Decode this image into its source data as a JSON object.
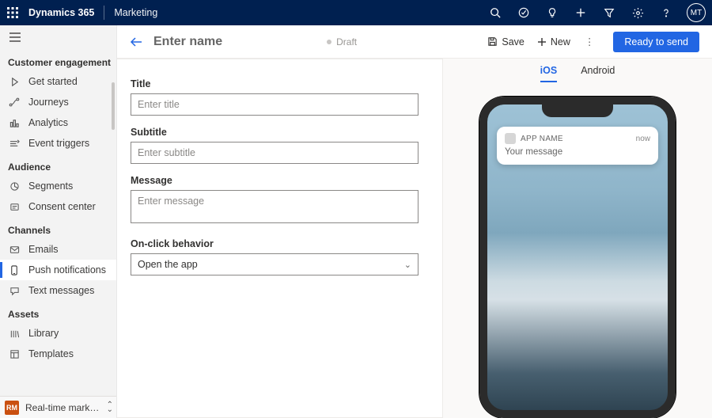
{
  "header": {
    "brand": "Dynamics 365",
    "module": "Marketing",
    "avatar_initials": "MT"
  },
  "sidebar": {
    "sections": [
      {
        "title": "Customer engagement",
        "items": [
          {
            "icon": "play",
            "label": "Get started"
          },
          {
            "icon": "journey",
            "label": "Journeys"
          },
          {
            "icon": "analytics",
            "label": "Analytics"
          },
          {
            "icon": "trigger",
            "label": "Event triggers"
          }
        ]
      },
      {
        "title": "Audience",
        "items": [
          {
            "icon": "segments",
            "label": "Segments"
          },
          {
            "icon": "consent",
            "label": "Consent center"
          }
        ]
      },
      {
        "title": "Channels",
        "items": [
          {
            "icon": "mail",
            "label": "Emails"
          },
          {
            "icon": "push",
            "label": "Push notifications",
            "active": true
          },
          {
            "icon": "text",
            "label": "Text messages"
          }
        ]
      },
      {
        "title": "Assets",
        "items": [
          {
            "icon": "library",
            "label": "Library"
          },
          {
            "icon": "templates",
            "label": "Templates"
          }
        ]
      }
    ],
    "switcher": {
      "tile": "RM",
      "label": "Real-time marketi..."
    }
  },
  "cmdbar": {
    "title": "Enter name",
    "status": "Draft",
    "save": "Save",
    "new": "New",
    "primary": "Ready to send"
  },
  "form": {
    "title_label": "Title",
    "title_ph": "Enter title",
    "subtitle_label": "Subtitle",
    "subtitle_ph": "Enter subtitle",
    "message_label": "Message",
    "message_ph": "Enter message",
    "onclick_label": "On-click behavior",
    "onclick_value": "Open the app"
  },
  "preview": {
    "tab_ios": "iOS",
    "tab_android": "Android",
    "app_name": "APP NAME",
    "time": "now",
    "message": "Your message"
  }
}
